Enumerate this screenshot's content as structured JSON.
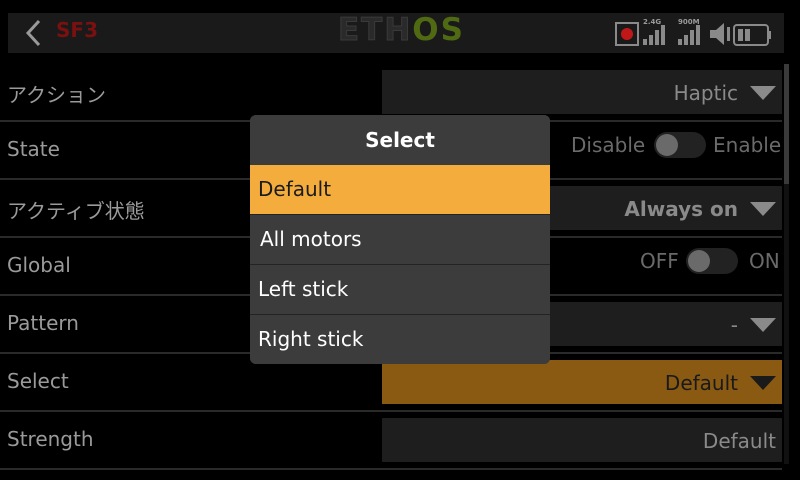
{
  "header": {
    "title": "SF3",
    "logo_left": "ETH",
    "logo_right": "OS",
    "status": {
      "signal_a_label": "2.4G",
      "signal_b_label": "900M"
    }
  },
  "rows": [
    {
      "label": "アクション",
      "value": "Haptic"
    },
    {
      "label": "State",
      "off_label": "Disable",
      "on_label": "Enable"
    },
    {
      "label": "アクティブ状態",
      "value": "Always on"
    },
    {
      "label": "Global",
      "off_label": "OFF",
      "on_label": "ON"
    },
    {
      "label": "Pattern",
      "value": "-"
    },
    {
      "label": "Select",
      "value": "Default"
    },
    {
      "label": "Strength",
      "value": "Default"
    }
  ],
  "dialog": {
    "title": "Select",
    "options": [
      "Default",
      "All motors",
      "Left stick",
      "Right stick"
    ],
    "selected": "Default"
  },
  "colors": {
    "accent": "#f4ad3d",
    "selected_field": "#8a5a12",
    "title_red": "#7a1010",
    "logo_green": "#4f6a12"
  }
}
